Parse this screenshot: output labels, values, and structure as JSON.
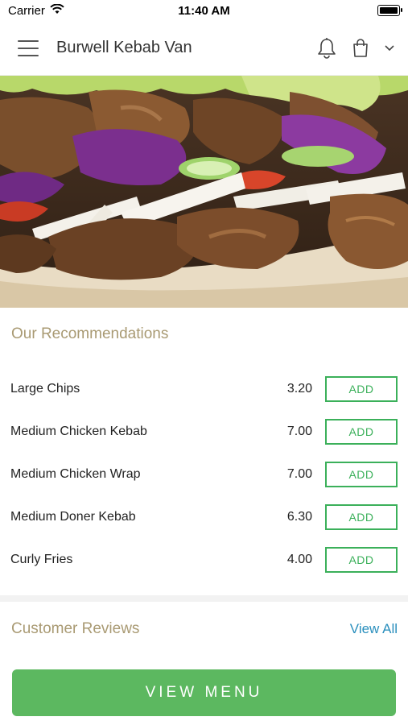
{
  "status_bar": {
    "carrier": "Carrier",
    "time": "11:40 AM"
  },
  "header": {
    "title": "Burwell Kebab Van",
    "icons": [
      "menu-icon",
      "bell-icon",
      "shopping-bag-icon",
      "chevron-down-icon"
    ]
  },
  "hero": {
    "alt": "doner-kebab-image"
  },
  "recommendations": {
    "title": "Our Recommendations",
    "add_label": "ADD",
    "items": [
      {
        "name": "Large Chips",
        "price": "3.20"
      },
      {
        "name": "Medium Chicken Kebab",
        "price": "7.00"
      },
      {
        "name": "Medium Chicken Wrap",
        "price": "7.00"
      },
      {
        "name": "Medium Doner Kebab",
        "price": "6.30"
      },
      {
        "name": "Curly Fries",
        "price": "4.00"
      }
    ]
  },
  "reviews": {
    "title": "Customer Reviews",
    "view_all": "View All"
  },
  "footer": {
    "view_menu": "VIEW MENU"
  },
  "colors": {
    "accent_green": "#3bb05a",
    "button_green": "#5cb860",
    "section_title": "#a99a73",
    "link_blue": "#2a8fbd"
  }
}
